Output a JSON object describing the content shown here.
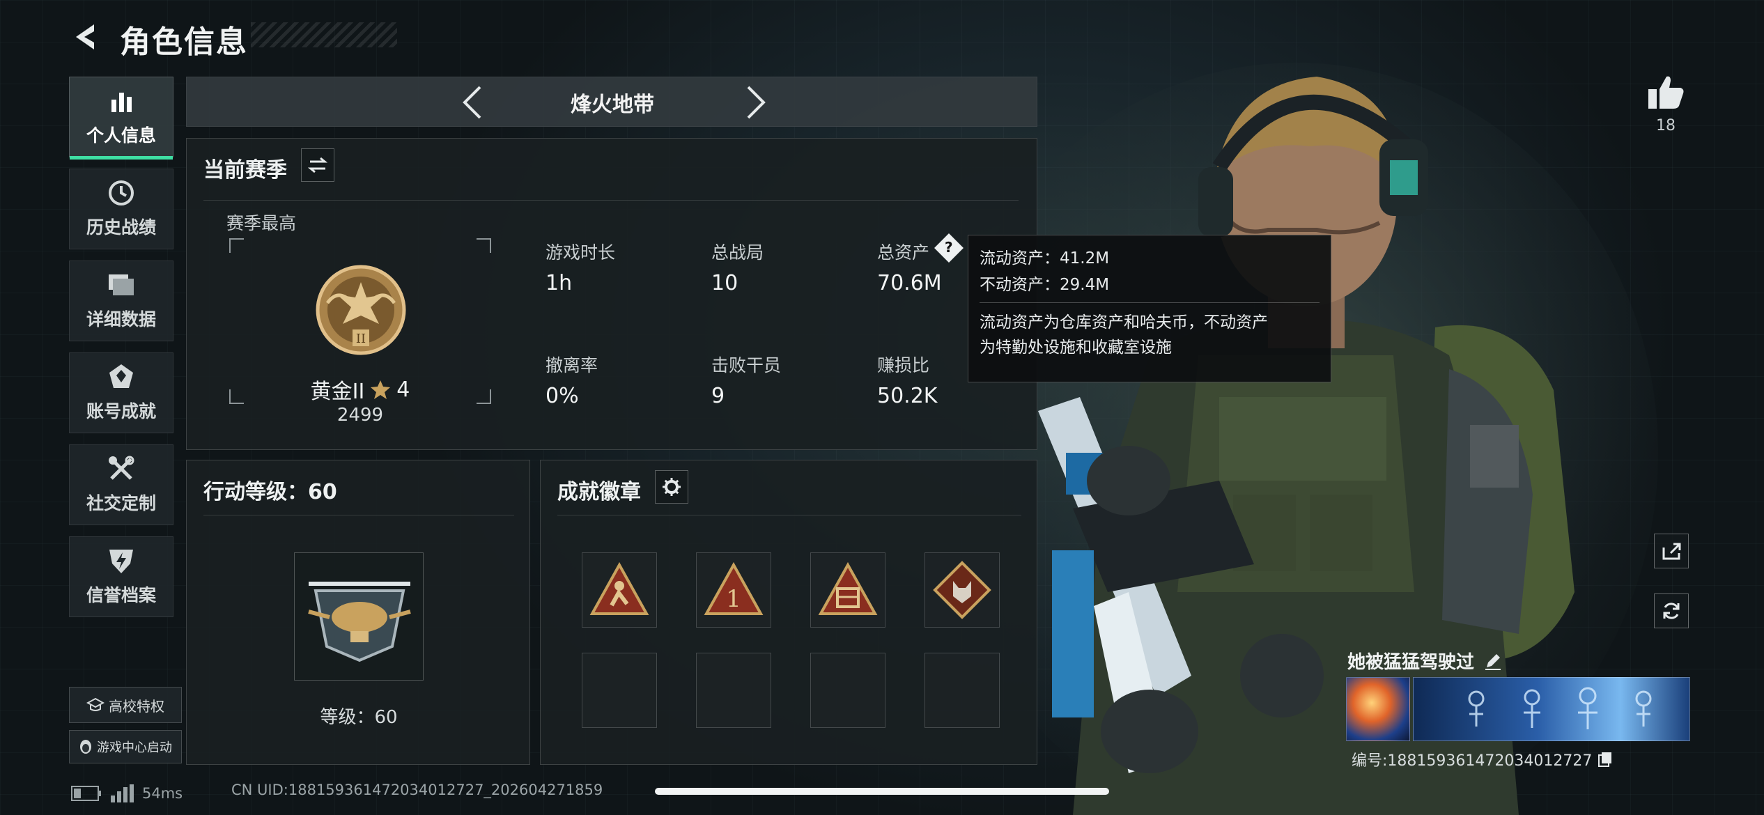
{
  "header": {
    "title": "角色信息"
  },
  "sidebar": {
    "items": [
      {
        "label": "个人信息",
        "icon": "bar-chart-icon",
        "active": true
      },
      {
        "label": "历史战绩",
        "icon": "clock-icon"
      },
      {
        "label": "详细数据",
        "icon": "folder-icon"
      },
      {
        "label": "账号成就",
        "icon": "achievement-icon"
      },
      {
        "label": "社交定制",
        "icon": "tools-icon"
      },
      {
        "label": "信誉档案",
        "icon": "shield-bolt-icon"
      }
    ],
    "campus_label": "高校特权",
    "launch_label": "游戏中心启动"
  },
  "nav": {
    "mode": "烽火地带"
  },
  "season": {
    "title": "当前赛季",
    "best_label": "赛季最高",
    "rank_name": "黄金II",
    "rank_stars": "4",
    "rank_points": "2499",
    "stats": [
      {
        "label": "游戏时长",
        "value": "1h"
      },
      {
        "label": "总战局",
        "value": "10"
      },
      {
        "label": "总资产",
        "value": "70.6M"
      },
      {
        "label": "撤离率",
        "value": "0%"
      },
      {
        "label": "击败干员",
        "value": "9"
      },
      {
        "label": "赚损比",
        "value": "50.2K"
      }
    ]
  },
  "tooltip": {
    "line1": "流动资产：41.2M",
    "line2": "不动资产：29.4M",
    "desc1": "流动资产为仓库资产和哈夫币，不动资产",
    "desc2": "为特勤处设施和收藏室设施"
  },
  "level": {
    "title": "行动等级：60",
    "caption": "等级：60"
  },
  "badges": {
    "title": "成就徽章",
    "slots_filled": 4,
    "slots_total": 8
  },
  "right": {
    "likes": "18",
    "player_name": "她被猛猛驾驶过",
    "id_text": "编号:18815936147203401272​7"
  },
  "footer": {
    "ping": "54ms",
    "uid": "CN UID:18815936147203401272​7_202604271859"
  },
  "colors": {
    "accent": "#3fdfa4",
    "gold": "#c9a25e",
    "badge_red": "#8a2e1f"
  }
}
